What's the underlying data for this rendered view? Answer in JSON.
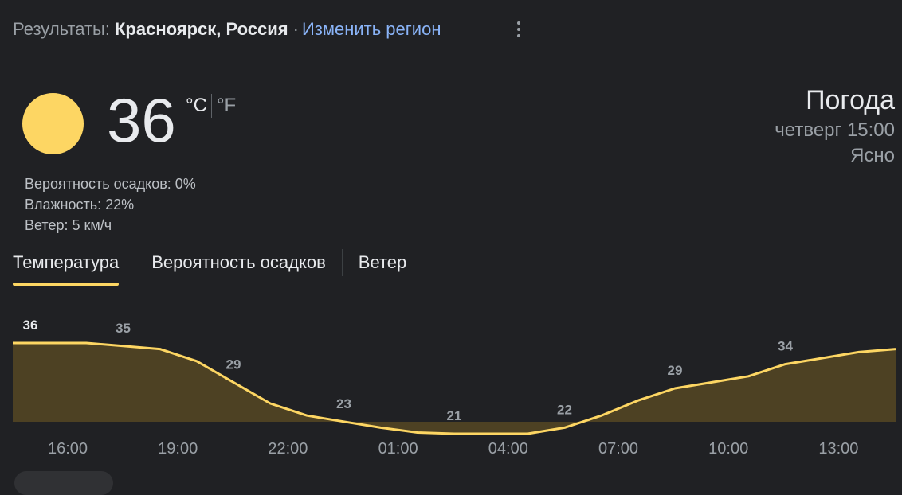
{
  "header": {
    "prefix": "Результаты:",
    "location": "Красноярск, Россия",
    "separator": "·",
    "change_region": "Изменить регион"
  },
  "current": {
    "temperature": "36",
    "unit_c": "°C",
    "unit_f": "°F",
    "icon": "sun-icon",
    "precipitation": "Вероятность осадков: 0%",
    "humidity": "Влажность: 22%",
    "wind": "Ветер: 5 км/ч"
  },
  "summary": {
    "title": "Погода",
    "datetime": "четверг 15:00",
    "condition": "Ясно"
  },
  "tabs": [
    {
      "label": "Температура",
      "active": true
    },
    {
      "label": "Вероятность осадков",
      "active": false
    },
    {
      "label": "Ветер",
      "active": false
    }
  ],
  "colors": {
    "background": "#202124",
    "accent": "#fdd663",
    "fill": "#4d4123",
    "link": "#8ab4f8"
  },
  "chart_data": {
    "type": "area",
    "x": [
      "16:00",
      "17:00",
      "18:00",
      "19:00",
      "20:00",
      "21:00",
      "22:00",
      "23:00",
      "00:00",
      "01:00",
      "02:00",
      "03:00",
      "04:00",
      "05:00",
      "06:00",
      "07:00",
      "08:00",
      "09:00",
      "10:00",
      "11:00",
      "12:00",
      "13:00",
      "14:00",
      "15:00",
      "16:00"
    ],
    "values": [
      36,
      36,
      36,
      35.5,
      35,
      33,
      29.5,
      26,
      24,
      23,
      22,
      21.2,
      21,
      21,
      21,
      22,
      24,
      26.5,
      28.5,
      29.5,
      30.5,
      32.5,
      33.5,
      34.5,
      35
    ],
    "point_labels": [
      {
        "index": 0,
        "value": "36"
      },
      {
        "index": 3,
        "value": "35"
      },
      {
        "index": 6,
        "value": "29"
      },
      {
        "index": 9,
        "value": "23"
      },
      {
        "index": 12,
        "value": "21"
      },
      {
        "index": 15,
        "value": "22"
      },
      {
        "index": 18,
        "value": "29"
      },
      {
        "index": 21,
        "value": "34"
      }
    ],
    "tick_labels": [
      "16:00",
      "19:00",
      "22:00",
      "01:00",
      "04:00",
      "07:00",
      "10:00",
      "13:00"
    ],
    "grid": false
  }
}
